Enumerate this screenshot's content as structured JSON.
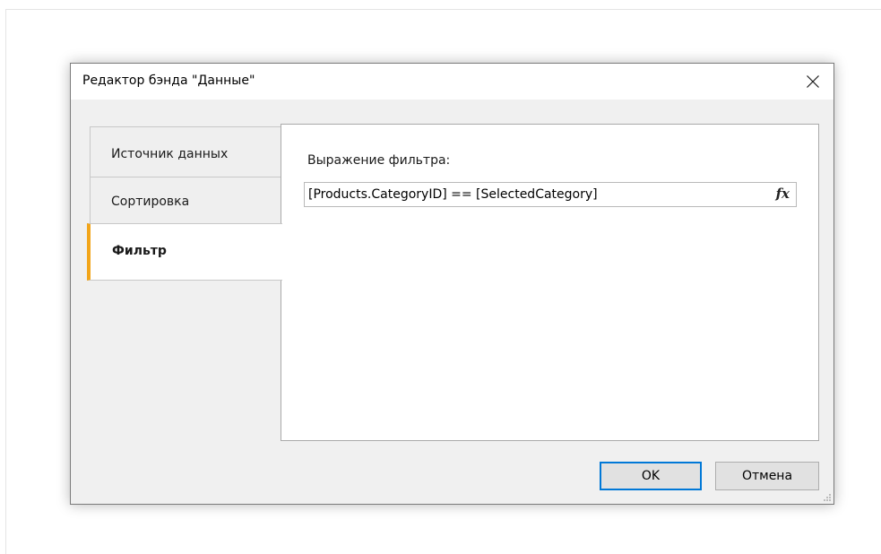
{
  "dialog": {
    "title": "Редактор бэнда \"Данные\"",
    "close_icon": "close-icon"
  },
  "tabs": [
    {
      "label": "Источник данных",
      "selected": false
    },
    {
      "label": "Сортировка",
      "selected": false
    },
    {
      "label": "Фильтр",
      "selected": true
    }
  ],
  "filter": {
    "label": "Выражение фильтра:",
    "value": "[Products.CategoryID] == [SelectedCategory]",
    "fx_icon": "fx",
    "fx_icon_name": "function-icon"
  },
  "buttons": {
    "ok": "OK",
    "cancel": "Отмена"
  },
  "colors": {
    "accent_tab": "#f2a51a",
    "focus_button": "#0078d7"
  }
}
